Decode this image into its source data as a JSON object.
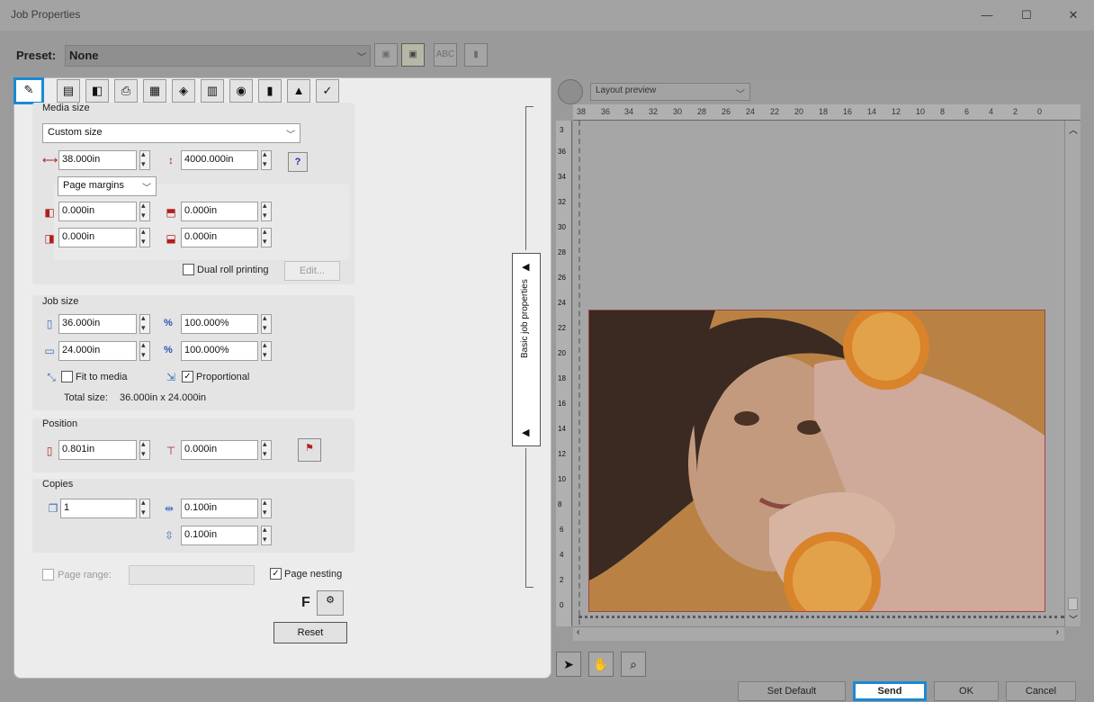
{
  "window": {
    "title": "Job Properties",
    "minimize_icon": "minimize-icon",
    "maximize_icon": "maximize-icon",
    "close_icon": "close-icon",
    "minimize": "—",
    "maximize": "☐",
    "close": "✕"
  },
  "preset": {
    "label": "Preset:",
    "value": "None"
  },
  "media_size": {
    "heading": "Media size",
    "type": "Custom size",
    "width": "38.000in",
    "height": "4000.000in",
    "margins_mode": "Page margins",
    "margin_left": "0.000in",
    "margin_top": "0.000in",
    "margin_right": "0.000in",
    "margin_bottom": "0.000in",
    "dual_roll_label": "Dual roll printing",
    "edit_label": "Edit..."
  },
  "job_size": {
    "heading": "Job size",
    "width": "36.000in",
    "width_pct": "100.000%",
    "height": "24.000in",
    "height_pct": "100.000%",
    "pct_symbol": "%",
    "fit_label": "Fit to media",
    "proportional_label": "Proportional",
    "total_label": "Total size:",
    "total_value": "36.000in x 24.000in"
  },
  "position": {
    "heading": "Position",
    "x": "0.801in",
    "y": "0.000in"
  },
  "copies": {
    "heading": "Copies",
    "count": "1",
    "h_gap": "0.100in",
    "v_gap": "0.100in"
  },
  "page_range_label": "Page range:",
  "page_nesting_label": "Page nesting",
  "f_label": "F",
  "reset_label": "Reset",
  "side_panel": {
    "label": "Basic job properties"
  },
  "preview": {
    "mode": "Layout preview",
    "ruler_top": [
      "38",
      "36",
      "34",
      "32",
      "30",
      "28",
      "26",
      "24",
      "22",
      "20",
      "18",
      "16",
      "14",
      "12",
      "10",
      "8",
      "6",
      "4",
      "2",
      "0"
    ],
    "ruler_left": [
      "3",
      "36",
      "34",
      "32",
      "30",
      "28",
      "26",
      "24",
      "22",
      "20",
      "18",
      "16",
      "14",
      "12",
      "10",
      "8",
      "6",
      "4",
      "2",
      "0"
    ]
  },
  "bottom": {
    "set_default": "Set Default",
    "send": "Send",
    "ok": "OK",
    "cancel": "Cancel"
  }
}
